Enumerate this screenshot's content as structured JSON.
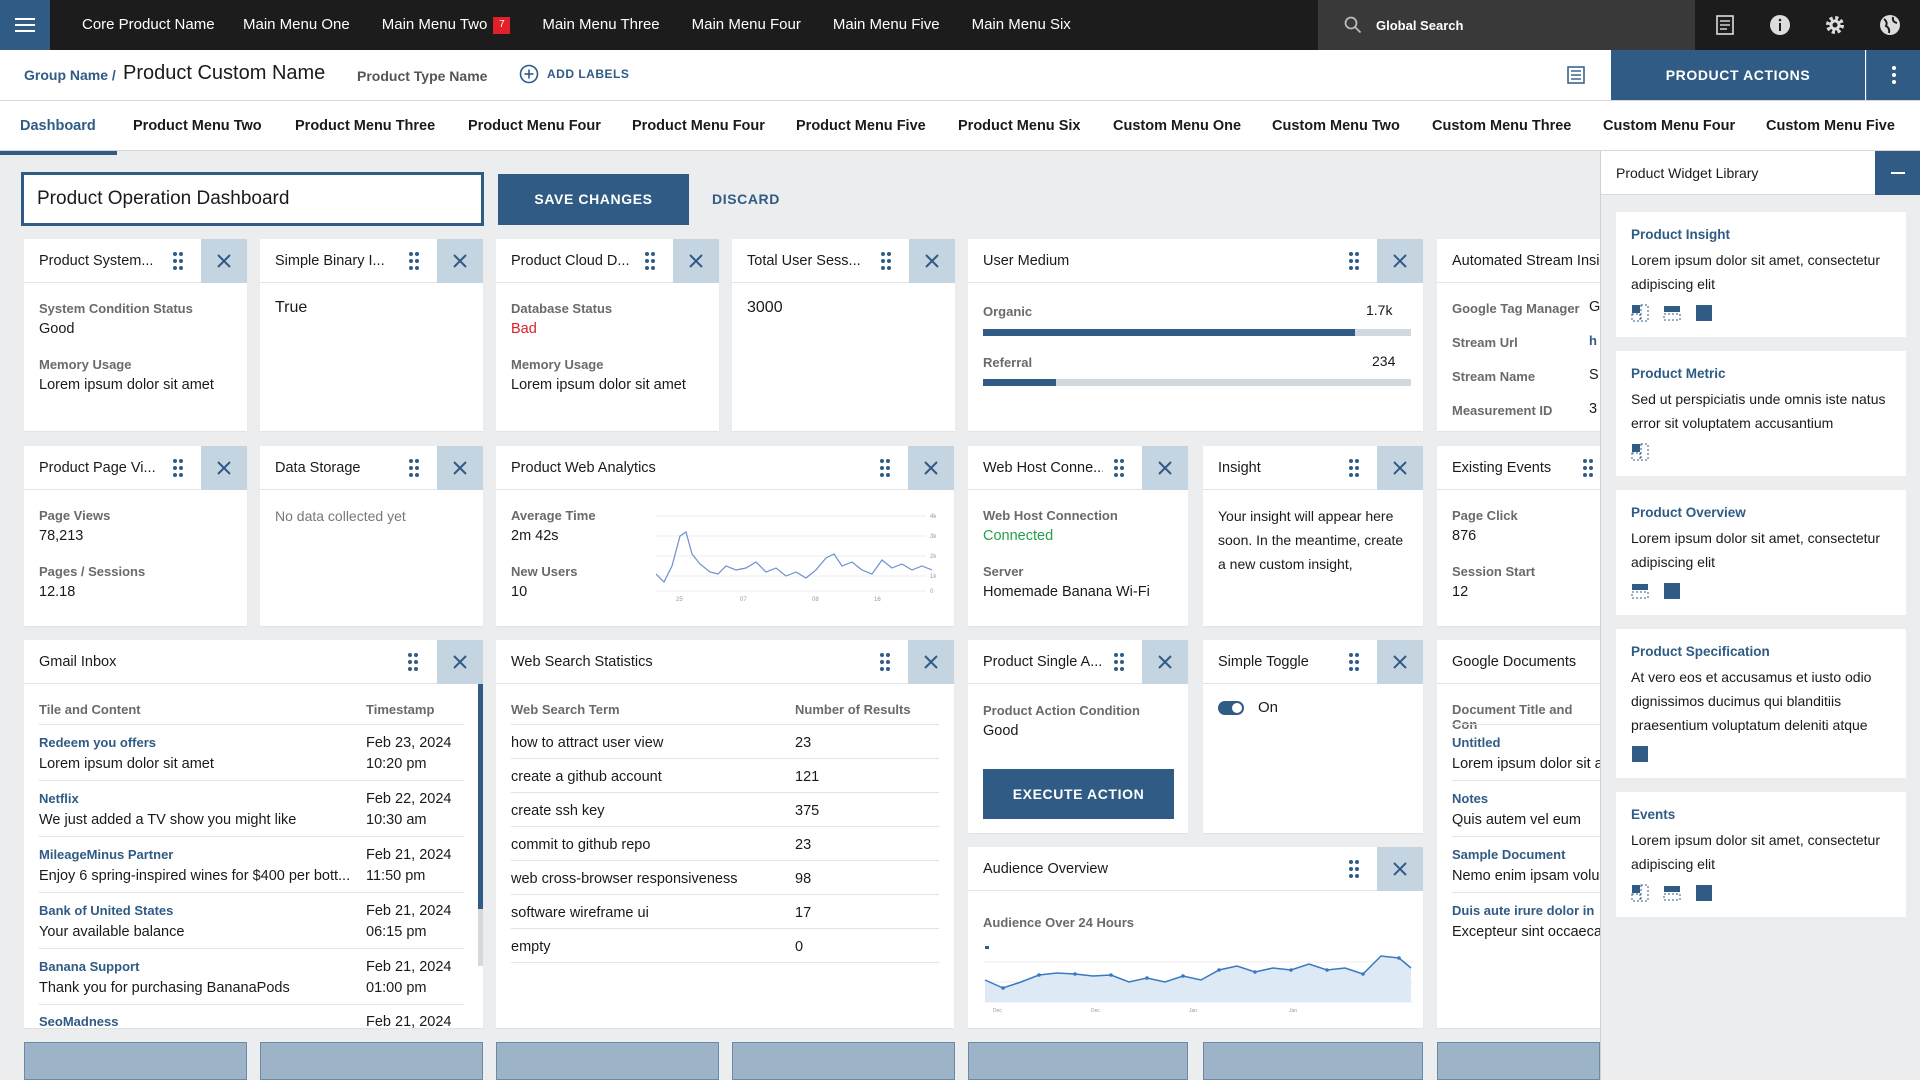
{
  "topbar": {
    "brand": "Core Product Name",
    "menu": [
      "Main Menu One",
      "Main Menu Two",
      "Main Menu Three",
      "Main Menu Four",
      "Main Menu Five",
      "Main Menu Six"
    ],
    "badge": "7",
    "search": "Global Search"
  },
  "subheader": {
    "group": "Group Name /",
    "product_name": "Product Custom Name",
    "type": "Product Type Name",
    "add_labels": "ADD LABELS",
    "product_actions": "PRODUCT ACTIONS"
  },
  "tabs": [
    "Dashboard",
    "Product Menu Two",
    "Product Menu Three",
    "Product Menu Four",
    "Product Menu Four",
    "Product Menu Five",
    "Product Menu Six",
    "Custom Menu One",
    "Custom Menu Two",
    "Custom Menu Three",
    "Custom Menu Four",
    "Custom Menu Five"
  ],
  "toolbar": {
    "title_value": "Product Operation Dashboard",
    "save": "SAVE CHANGES",
    "discard": "DISCARD"
  },
  "cards": {
    "system": {
      "title": "Product System...",
      "l1": "System Condition Status",
      "v1": "Good",
      "l2": "Memory Usage",
      "v2": "Lorem ipsum dolor sit amet"
    },
    "binary": {
      "title": "Simple Binary I...",
      "value": "True"
    },
    "cloud": {
      "title": "Product Cloud D...",
      "l1": "Database Status",
      "v1": "Bad",
      "l2": "Memory Usage",
      "v2": "Lorem ipsum dolor sit amet"
    },
    "sessions": {
      "title": "Total User Sess...",
      "value": "3000"
    },
    "medium": {
      "title": "User Medium",
      "r1": "Organic",
      "v1": "1.7k",
      "f1": 0.87,
      "r2": "Referral",
      "v2": "234",
      "f2": 0.17
    },
    "stream": {
      "title": "Automated Stream Insi",
      "rows": [
        [
          "Google Tag Manager",
          "G"
        ],
        [
          "Stream Url",
          "h"
        ],
        [
          "Stream Name",
          "S"
        ],
        [
          "Measurement ID",
          "3"
        ]
      ]
    },
    "pageviews": {
      "title": "Product Page Vi...",
      "l1": "Page Views",
      "v1": "78,213",
      "l2": "Pages / Sessions",
      "v2": "12.18"
    },
    "storage": {
      "title": "Data Storage",
      "empty": "No data collected yet"
    },
    "webanalytics": {
      "title": "Product Web Analytics",
      "l1": "Average Time",
      "v1": "2m 42s",
      "l2": "New Users",
      "v2": "10"
    },
    "webhost": {
      "title": "Web Host Conne...",
      "l1": "Web Host Connection",
      "v1": "Connected",
      "l2": "Server",
      "v2": "Homemade Banana Wi-Fi"
    },
    "insight": {
      "title": "Insight",
      "text": "Your insight will appear here soon. In the meantime, create a new custom insight,"
    },
    "events": {
      "title": "Existing Events",
      "l1": "Page Click",
      "v1": "876",
      "l2": "Session Start",
      "v2": "12"
    },
    "gmail": {
      "title": "Gmail Inbox",
      "h1": "Tile and Content",
      "h2": "Timestamp",
      "rows": [
        {
          "from": "Redeem you offers",
          "msg": "Lorem ipsum dolor sit amet",
          "date": "Feb 23, 2024",
          "time": "10:20 pm"
        },
        {
          "from": "Netflix",
          "msg": "We just added a TV show you might like",
          "date": "Feb 22, 2024",
          "time": "10:30 am"
        },
        {
          "from": "MileageMinus Partner",
          "msg": "Enjoy 6 spring-inspired wines for $400 per bott...",
          "date": "Feb 21, 2024",
          "time": "11:50 pm"
        },
        {
          "from": "Bank of United States",
          "msg": "Your available balance",
          "date": "Feb 21, 2024",
          "time": "06:15 pm"
        },
        {
          "from": "Banana Support",
          "msg": "Thank you for purchasing BananaPods",
          "date": "Feb 21, 2024",
          "time": "01:00 pm"
        },
        {
          "from": "SeoMadness",
          "msg": "",
          "date": "Feb 21, 2024",
          "time": ""
        }
      ]
    },
    "websearch": {
      "title": "Web Search Statistics",
      "h1": "Web Search Term",
      "h2": "Number of Results",
      "rows": [
        [
          "how to attract user view",
          "23"
        ],
        [
          "create a github account",
          "121"
        ],
        [
          "create ssh key",
          "375"
        ],
        [
          "commit to github repo",
          "23"
        ],
        [
          "web cross-browser responsiveness",
          "98"
        ],
        [
          "software wireframe ui",
          "17"
        ],
        [
          "empty",
          "0"
        ]
      ]
    },
    "single": {
      "title": "Product Single A...",
      "l1": "Product Action Condition",
      "v1": "Good",
      "button": "EXECUTE ACTION"
    },
    "toggle": {
      "title": "Simple Toggle",
      "state": "On"
    },
    "gdocs": {
      "title": "Google Documents",
      "h1": "Document Title and Con",
      "rows": [
        [
          "Untitled",
          "Lorem ipsum dolor sit a"
        ],
        [
          "Notes",
          "Quis autem vel eum"
        ],
        [
          "Sample Document",
          "Nemo enim ipsam volu"
        ],
        [
          "Duis aute irure dolor in",
          "Excepteur sint occaeca"
        ]
      ]
    },
    "audience": {
      "title": "Audience Overview",
      "label": "Audience Over 24 Hours"
    }
  },
  "widget_library": {
    "title": "Product Widget Library",
    "items": [
      {
        "title": "Product Insight",
        "desc": "Lorem ipsum dolor sit amet, consectetur adipiscing elit"
      },
      {
        "title": "Product Metric",
        "desc": "Sed ut perspiciatis unde omnis iste natus error sit voluptatem accusantium"
      },
      {
        "title": "Product Overview",
        "desc": "Lorem ipsum dolor sit amet, consectetur adipiscing elit"
      },
      {
        "title": "Product Specification",
        "desc": "At vero eos et accusamus et iusto odio dignissimos ducimus qui blanditiis praesentium voluptatum deleniti atque"
      },
      {
        "title": "Events",
        "desc": "Lorem ipsum dolor sit amet, consectetur adipiscing elit"
      }
    ]
  },
  "colors": {
    "primary": "#2f5b85",
    "topbar": "#1c1c1c",
    "bad": "#da1e28",
    "good": "#24a148",
    "close_bg": "#c5d4e1"
  }
}
